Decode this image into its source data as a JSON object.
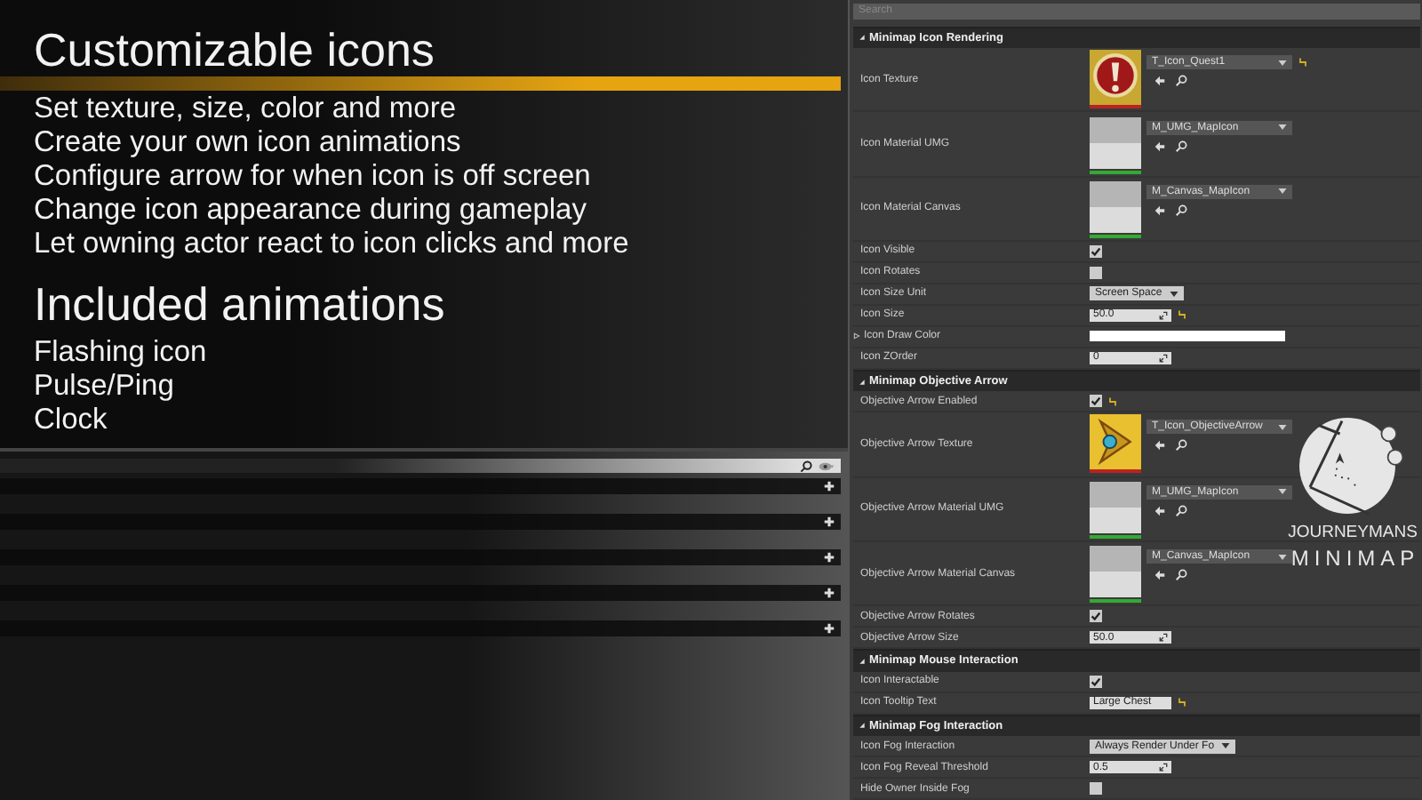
{
  "overlay": {
    "heading_1": "Customizable icons",
    "features": [
      "Set texture, size, color and more",
      "Create your own icon animations",
      "Configure arrow for when icon is off screen",
      "Change icon appearance during gameplay",
      "Let owning actor react to icon clicks and more"
    ],
    "heading_2": "Included animations",
    "animations": [
      "Flashing icon",
      "Pulse/Ping",
      "Clock"
    ]
  },
  "editor": {
    "categories": [
      {
        "kind": "bar"
      },
      {
        "kind": "bar"
      },
      {
        "kind": "bar"
      },
      {
        "kind": "bar"
      },
      {
        "kind": "bar"
      }
    ]
  },
  "details": {
    "search": {
      "placeholder": "Search"
    },
    "sections": [
      {
        "title": "Minimap Icon Rendering",
        "expanded": true,
        "rows": [
          {
            "kind": "asset",
            "label": "Icon Texture",
            "asset": "T_Icon_Quest1",
            "thumb": {
              "kind": "quest"
            },
            "reset": true
          },
          {
            "kind": "asset",
            "label": "Icon Material UMG",
            "asset": "M_UMG_MapIcon",
            "thumb": {
              "kind": "material"
            }
          },
          {
            "kind": "asset",
            "label": "Icon Material Canvas",
            "asset": "M_Canvas_MapIcon",
            "thumb": {
              "kind": "material"
            }
          },
          {
            "kind": "checkbox",
            "label": "Icon Visible",
            "checked": true
          },
          {
            "kind": "checkbox",
            "label": "Icon Rotates",
            "checked": false
          },
          {
            "kind": "dropdown",
            "label": "Icon Size Unit",
            "value": "Screen Space"
          },
          {
            "kind": "number",
            "label": "Icon Size",
            "value": "50.0",
            "reset": true
          },
          {
            "kind": "color",
            "label": "Icon Draw Color",
            "expandable": true
          },
          {
            "kind": "number",
            "label": "Icon ZOrder",
            "value": "0"
          }
        ]
      },
      {
        "title": "Minimap Objective Arrow",
        "expanded": true,
        "rows": [
          {
            "kind": "checkbox",
            "label": "Objective Arrow Enabled",
            "checked": true,
            "reset": true
          },
          {
            "kind": "asset",
            "label": "Objective Arrow Texture",
            "asset": "T_Icon_ObjectiveArrow",
            "thumb": {
              "kind": "arrow"
            }
          },
          {
            "kind": "asset",
            "label": "Objective Arrow Material UMG",
            "asset": "M_UMG_MapIcon",
            "thumb": {
              "kind": "material"
            }
          },
          {
            "kind": "asset",
            "label": "Objective Arrow Material Canvas",
            "asset": "M_Canvas_MapIcon",
            "thumb": {
              "kind": "material"
            }
          },
          {
            "kind": "checkbox",
            "label": "Objective Arrow Rotates",
            "checked": true
          },
          {
            "kind": "number",
            "label": "Objective Arrow Size",
            "value": "50.0"
          }
        ]
      },
      {
        "title": "Minimap Mouse Interaction",
        "expanded": true,
        "rows": [
          {
            "kind": "checkbox",
            "label": "Icon Interactable",
            "checked": true
          },
          {
            "kind": "text",
            "label": "Icon Tooltip Text",
            "value": "Large Chest",
            "reset": true
          }
        ]
      },
      {
        "title": "Minimap Fog Interaction",
        "expanded": true,
        "rows": [
          {
            "kind": "dropdown",
            "label": "Icon Fog Interaction",
            "value": "Always Render Under Fo"
          },
          {
            "kind": "number",
            "label": "Icon Fog Reveal Threshold",
            "value": "0.5"
          },
          {
            "kind": "checkbox",
            "label": "Hide Owner Inside Fog",
            "checked": false
          }
        ]
      }
    ]
  },
  "logo": {
    "line_1": "JOURNEYMANS",
    "line_2": "MINIMAP"
  }
}
